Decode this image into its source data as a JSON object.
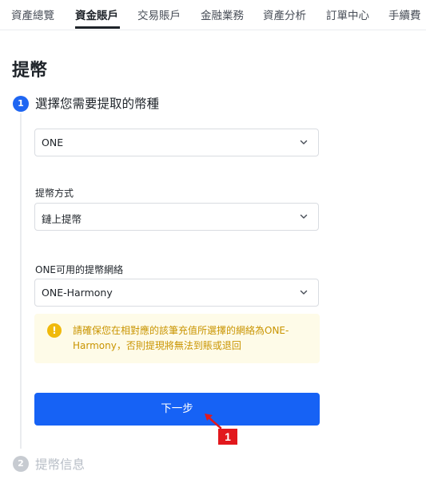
{
  "nav": {
    "tabs": [
      "資產總覽",
      "資金賬戶",
      "交易賬戶",
      "金融業務",
      "資產分析",
      "訂單中心",
      "手續費"
    ],
    "active_index": 1
  },
  "page": {
    "title": "提幣"
  },
  "steps": {
    "step1": {
      "number": "1",
      "title": "選擇您需要提取的幣種"
    },
    "step2": {
      "number": "2",
      "title": "提幣信息"
    }
  },
  "form": {
    "coin": {
      "value": "ONE",
      "icon": "chevron-down-icon"
    },
    "method": {
      "label": "提幣方式",
      "value": "鏈上提幣",
      "icon": "chevron-down-icon"
    },
    "network": {
      "label": "ONE可用的提幣網絡",
      "value": "ONE-Harmony",
      "icon": "chevron-down-icon"
    }
  },
  "notice": {
    "icon": "warning-icon",
    "icon_glyph": "!",
    "text": "請確保您在相對應的該筆充值所選擇的網絡為ONE-Harmony，否則提現將無法到賬或退回"
  },
  "next_button": {
    "label": "下一步"
  },
  "annotation": {
    "number": "1"
  },
  "colors": {
    "accent": "#1662f5",
    "step_active": "#1f66f2",
    "warning": "#f0b90b",
    "warning_bg": "#fefbe8",
    "annotation_red": "#e2181d"
  }
}
